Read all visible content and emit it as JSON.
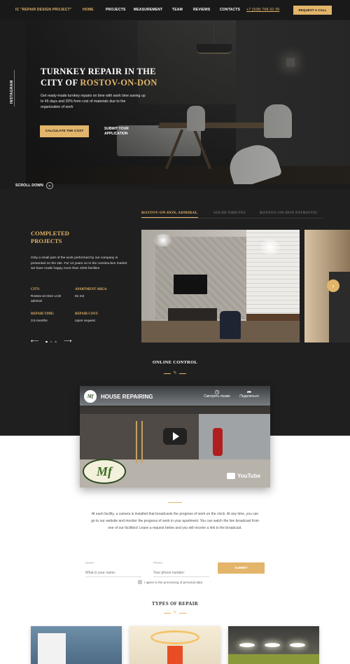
{
  "nav": {
    "logo": "IC \"REPAIR DESIGN PROJECT\"",
    "links": [
      "HOME",
      "PROJECTS",
      "MEASUREMENT",
      "TEAM",
      "REVIEWS",
      "CONTACTS"
    ],
    "phone": "+7 (928) 768-32-39",
    "cta": "REQUEST A CALL"
  },
  "hero": {
    "title_line1": "TURNKEY REPAIR IN THE",
    "title_line2_prefix": "CITY OF ",
    "title_city": "ROSTOV-ON-DON",
    "subtitle": "Get ready-made turnkey repairs on time with work time saving up to 45 days and 20% from cost of materials due to the organization of work",
    "calc_button": "CALCULATE THE COST",
    "submit_app": "SUBMIT YOUR APPLICATION",
    "instagram": "INSTAGRAM",
    "scroll": "SCROLL DOWN"
  },
  "projects": {
    "tabs": [
      "ROSTOV-ON-DON, ADMIRAL",
      "SOCHI THIEVES",
      "ROSTOV-ON-DON PATRIOTIC"
    ],
    "title": "COMPLETED PROJECTS",
    "description": "Only a small part of the work performed by our company is presented on the site. For 14 years on in the construction market we have made happy more than 1000 families",
    "city_label": "CITY:",
    "city_value": "Rostov-on-Don LCD admiral",
    "area_label": "APARTMENT AREA:",
    "area_value": "81 m2",
    "time_label": "REPAIR TIME:",
    "time_value": "3.5 months",
    "cost_label": "REPAIR COST:",
    "cost_value": "Upon request",
    "slide_current": 1,
    "slide_total": 3
  },
  "online_control": {
    "title": "ONLINE CONTROL",
    "video_title": "HOUSE REPAIRING",
    "watch_later": "Смотреть позже",
    "share": "Поделиться",
    "youtube": "YouTube",
    "text": "At each facility, a camera is installed that broadcasts the progress of work on the clock. At any time, you can go to our website and monitor the progress of work in your apartment. You can watch the live broadcast from one of our facilities! Leave a request below and you will receive a link to the broadcast.",
    "name_label": "Name",
    "name_placeholder": "What is your name:",
    "phone_label": "Phone",
    "phone_placeholder": "Your phone number:",
    "submit": "SUBMIT",
    "agree": "I agree to the processing of personal data"
  },
  "types": {
    "title": "TYPES OF REPAIR"
  },
  "colors": {
    "accent": "#e3b56a",
    "dark_bg": "#1f1f1f",
    "white_bg": "#ffffff"
  }
}
